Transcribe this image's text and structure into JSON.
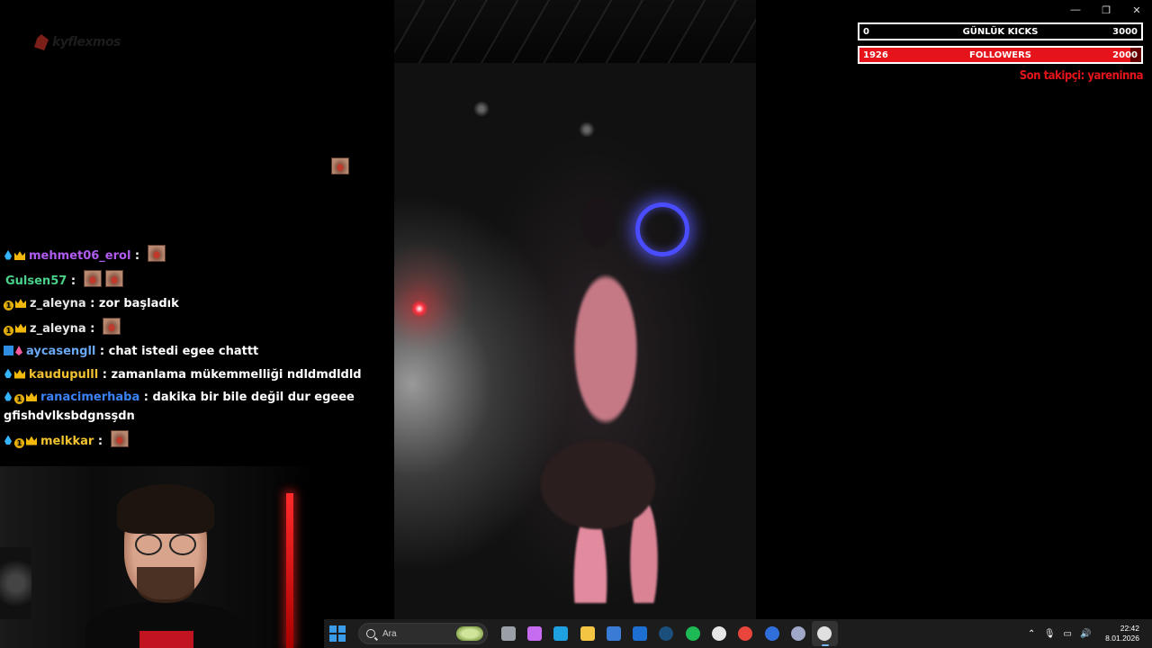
{
  "window": {
    "minimize": "—",
    "restore": "❐",
    "close": "✕"
  },
  "logo": {
    "text": "kyflexmos"
  },
  "overlay": {
    "kicks": {
      "current": "0",
      "label": "GÜNLÜK KICKS",
      "goal": "3000",
      "progress": 0
    },
    "followers": {
      "current": "1926",
      "label": "FOLLOWERS",
      "goal": "2000",
      "progress": 0.963
    },
    "last_follower": "Son takipçi: yareninna",
    "accent_color": "#e4141a"
  },
  "chat": {
    "messages": [
      {
        "badges": [
          "drop",
          "crown"
        ],
        "user": "mehmet06_erol",
        "user_color": "#b05cf0",
        "text": "",
        "emotes": 1
      },
      {
        "badges": [],
        "user": "Gulsen57",
        "user_color": "#49d18a",
        "text": "",
        "emotes": 2
      },
      {
        "badges": [
          "one",
          "crown"
        ],
        "user": "z_aleyna",
        "user_color": "#e6e6e6",
        "text": "zor başladık",
        "emotes": 0
      },
      {
        "badges": [
          "one",
          "crown"
        ],
        "user": "z_aleyna",
        "user_color": "#e6e6e6",
        "text": "",
        "emotes": 1
      },
      {
        "badges": [
          "arrow",
          "flame"
        ],
        "user": "aycasengll",
        "user_color": "#6aa8f4",
        "text": "chat istedi egee chattt",
        "emotes": 0
      },
      {
        "badges": [
          "drop",
          "crown"
        ],
        "user": "kaudupulll",
        "user_color": "#f2c230",
        "text": "zamanlama mükemmelliği ndldmdldld",
        "emotes": 0
      },
      {
        "badges": [
          "drop",
          "one",
          "crown"
        ],
        "user": "ranacimerhaba",
        "user_color": "#3b82f6",
        "text": "dakika bir bile değil dur egeee gfishdvlksbdgnsşdn",
        "emotes": 0
      },
      {
        "badges": [
          "drop",
          "one",
          "crown"
        ],
        "user": "melkkar",
        "user_color": "#f2c230",
        "text": "",
        "emotes": 1
      }
    ]
  },
  "taskbar": {
    "search_placeholder": "Ara",
    "apps": [
      {
        "name": "task-view-icon",
        "color": "#9aa0a6"
      },
      {
        "name": "copilot-icon",
        "color": "#c56cf0"
      },
      {
        "name": "edge-icon",
        "color": "#1fa0e0"
      },
      {
        "name": "file-explorer-icon",
        "color": "#f4c542"
      },
      {
        "name": "store-icon",
        "color": "#3a7bd5"
      },
      {
        "name": "outlook-icon",
        "color": "#1d6fd1"
      },
      {
        "name": "steam-icon",
        "color": "#1b4e7a"
      },
      {
        "name": "spotify-icon",
        "color": "#1db954"
      },
      {
        "name": "github-icon",
        "color": "#e6e6e6"
      },
      {
        "name": "chrome-icon",
        "color": "#e8453c"
      },
      {
        "name": "app-blue-icon",
        "color": "#2f6fdc"
      },
      {
        "name": "settings-icon",
        "color": "#9fa8c8"
      },
      {
        "name": "media-player-icon",
        "color": "#e0e0e0"
      }
    ],
    "clock_time": "22:42",
    "clock_date": "8.01.2026"
  }
}
